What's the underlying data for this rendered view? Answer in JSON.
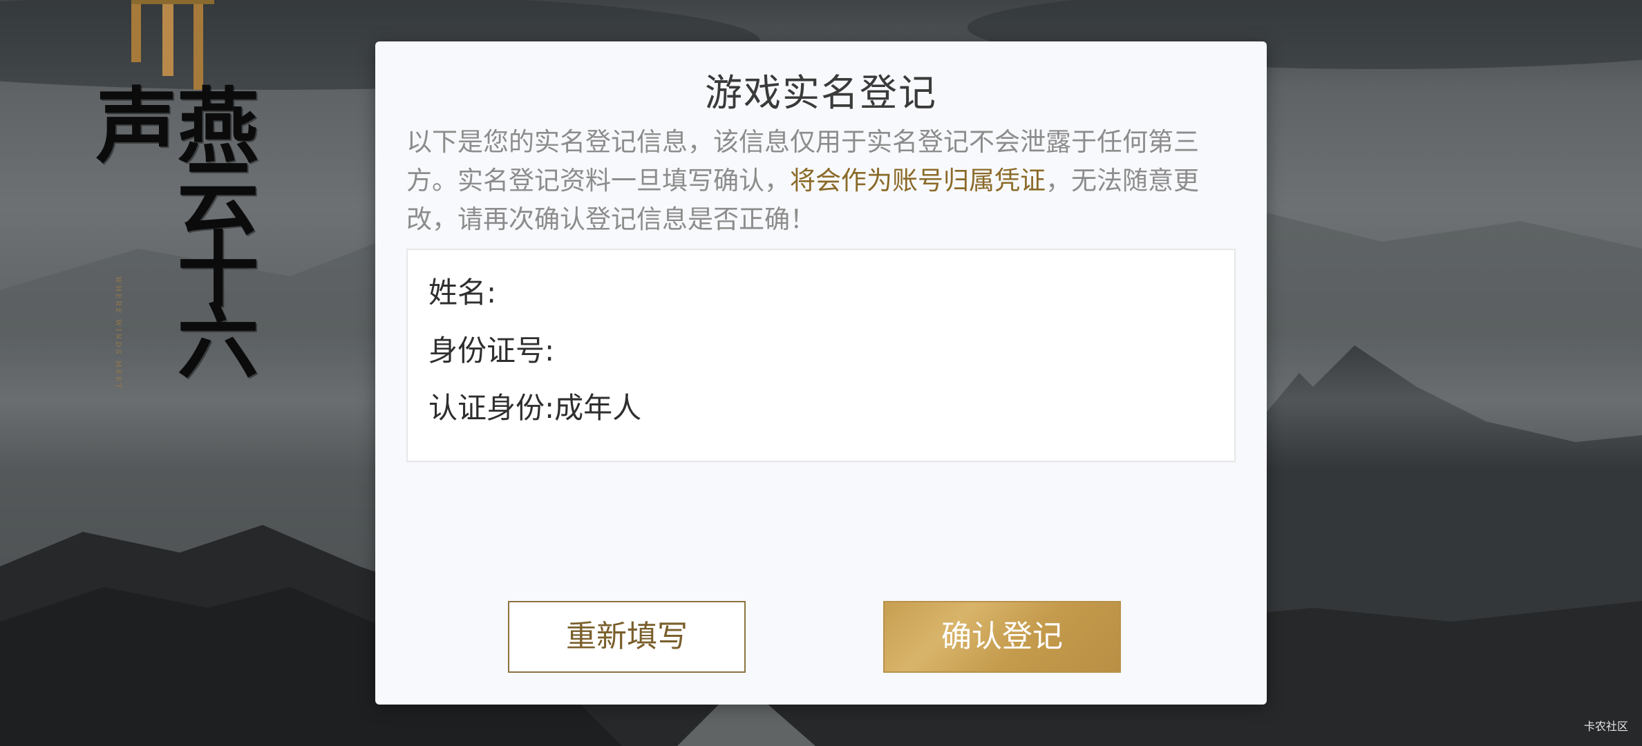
{
  "logo": {
    "title": "燕云十六声",
    "subtitle": "WHERE WINDS MEET"
  },
  "dialog": {
    "title": "游戏实名登记",
    "notice_part1": "以下是您的实名登记信息，该信息仅用于实名登记不会泄露于任何第三方。实名登记资料一旦填写确认，",
    "notice_highlight": "将会作为账号归属凭证",
    "notice_part2": "，无法随意更改，请再次确认登记信息是否正确！",
    "fields": {
      "name_label": "姓名:",
      "name_value": "",
      "id_label": "身份证号:",
      "id_value": "",
      "status_label": "认证身份:",
      "status_value": "成年人"
    },
    "buttons": {
      "reset": "重新填写",
      "confirm": "确认登记"
    }
  },
  "watermark": "卡农社区",
  "colors": {
    "accent_gold": "#c49a4c",
    "highlight_text": "#8a6a28",
    "dialog_bg": "#f8f9fc"
  }
}
